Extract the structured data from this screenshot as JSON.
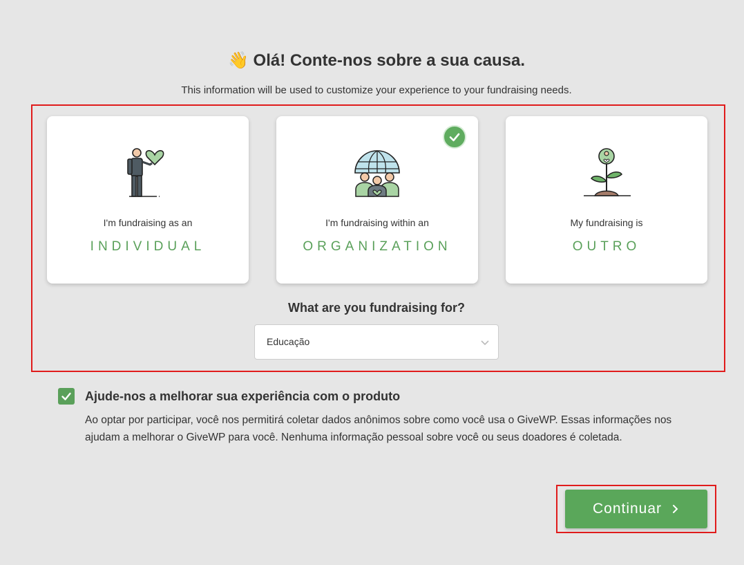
{
  "header": {
    "emoji": "👋",
    "title": "Olá! Conte-nos sobre a sua causa.",
    "subtitle": "This information will be used to customize your experience to your fundraising needs."
  },
  "cards": [
    {
      "pre": "I'm fundraising as an",
      "kind": "INDIVIDUAL",
      "icon": "person-heart-icon",
      "selected": false
    },
    {
      "pre": "I'm fundraising within an",
      "kind": "ORGANIZATION",
      "icon": "globe-group-icon",
      "selected": true
    },
    {
      "pre": "My fundraising is",
      "kind": "OUTRO",
      "icon": "plant-heart-icon",
      "selected": false
    }
  ],
  "cause": {
    "question": "What are you fundraising for?",
    "selected": "Educação"
  },
  "optin": {
    "checked": true,
    "title": "Ajude-nos a melhorar sua experiência com o produto",
    "description": "Ao optar por participar, você nos permitirá coletar dados anônimos sobre como você usa o GiveWP. Essas informações nos ajudam a melhorar o GiveWP para você. Nenhuma informação pessoal sobre você ou seus doadores é coletada."
  },
  "footer": {
    "continue_label": "Continuar"
  },
  "colors": {
    "accent": "#5aa05a",
    "highlight": "#e01b1b"
  }
}
